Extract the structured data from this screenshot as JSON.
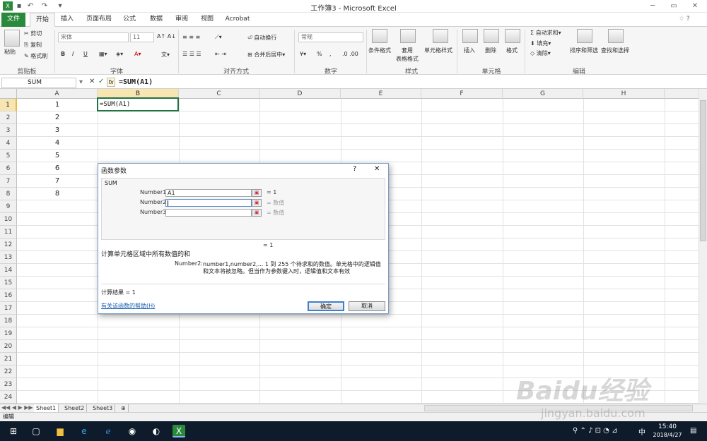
{
  "window": {
    "title": "工作簿3 - Microsoft Excel",
    "min_icon": "minimize-icon",
    "max_icon": "maximize-icon",
    "close_icon": "close-icon"
  },
  "quick_access": {
    "save_icon": "save-icon",
    "undo_icon": "undo-icon",
    "redo_icon": "redo-icon"
  },
  "tabs": [
    "文件",
    "开始",
    "插入",
    "页面布局",
    "公式",
    "数据",
    "审阅",
    "视图",
    "Acrobat"
  ],
  "ribbon": {
    "clipboard": {
      "paste": "粘贴",
      "cut": "剪切",
      "copy": "复制",
      "format_painter": "格式刷",
      "label": "剪贴板"
    },
    "font": {
      "name": "宋体",
      "size": "11",
      "bold": "B",
      "italic": "I",
      "underline": "U",
      "label": "字体"
    },
    "alignment": {
      "wrap": "自动换行",
      "merge": "合并后居中",
      "label": "对齐方式"
    },
    "number": {
      "format": "常规",
      "percent": "%",
      "comma": ",",
      "label": "数字"
    },
    "styles": {
      "conditional": "条件格式",
      "table": "套用",
      "table2": "表格格式",
      "cell_styles": "单元格样式",
      "label": "样式"
    },
    "cells": {
      "insert": "插入",
      "delete": "删除",
      "format": "格式",
      "label": "单元格"
    },
    "editing": {
      "autosum": "自动求和",
      "fill": "填充",
      "clear": "清除",
      "sort": "排序和筛选",
      "find": "查找和选择",
      "label": "编辑"
    }
  },
  "formula_bar": {
    "name_box": "SUM",
    "formula": "=SUM(A1)",
    "fx": "fx"
  },
  "columns": [
    "A",
    "B",
    "C",
    "D",
    "E",
    "F",
    "G",
    "H"
  ],
  "rows": [
    "1",
    "2",
    "3",
    "4",
    "5",
    "6",
    "7",
    "8",
    "9",
    "10",
    "11",
    "12",
    "13",
    "14",
    "15",
    "16",
    "17",
    "18",
    "19",
    "20",
    "21",
    "22",
    "23",
    "24"
  ],
  "cells": {
    "A1": "1",
    "A2": "2",
    "A3": "3",
    "A4": "4",
    "A5": "5",
    "A6": "6",
    "A7": "7",
    "A8": "8",
    "B1": "=SUM(A1)"
  },
  "sheets": [
    "Sheet1",
    "Sheet2",
    "Sheet3"
  ],
  "status": "编辑",
  "dialog": {
    "title": "函数参数",
    "help_q": "?",
    "close": "✕",
    "func": "SUM",
    "args": [
      {
        "name": "Number1",
        "value": "A1",
        "result": "= 1"
      },
      {
        "name": "Number2",
        "value": "",
        "result": "= 数值"
      },
      {
        "name": "Number3",
        "value": "",
        "result": "= 数值"
      }
    ],
    "total": "= 1",
    "description": "计算单元格区域中所有数值的和",
    "arg_help_name": "Number2:",
    "arg_help_1": "number1,number2,...  1 到 255 个待求和的数值。单元格中的逻辑值",
    "arg_help_2": "和文本将被忽略。但当作为参数键入时，逻辑值和文本有效",
    "result_label": "计算结果 = 1",
    "help_link": "有关该函数的帮助(H)",
    "ok": "确定",
    "cancel": "取消"
  },
  "taskbar": {
    "time": "15:40",
    "date": "2018/4/27",
    "ime": "中"
  },
  "watermark": {
    "text": "Baidu经验",
    "url": "jingyan.baidu.com"
  }
}
